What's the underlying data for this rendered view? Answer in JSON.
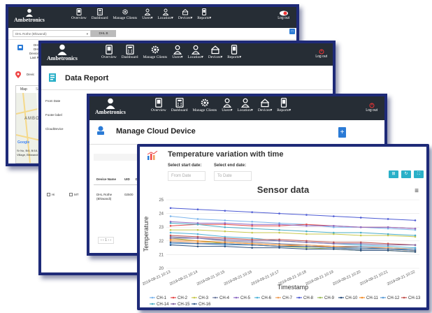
{
  "nav": {
    "brand": "Ambetronics",
    "items": [
      {
        "label": "Overview",
        "icon": "tablet-icon"
      },
      {
        "label": "Dashboard",
        "icon": "calculator-icon"
      },
      {
        "label": "Manage Clients",
        "icon": "gear-icon"
      },
      {
        "label": "Users▾",
        "icon": "user-icon"
      },
      {
        "label": "Location▾",
        "icon": "user-icon"
      },
      {
        "label": "Devices▾",
        "icon": "router-icon"
      },
      {
        "label": "Reports▾",
        "icon": "phone-icon"
      }
    ],
    "logout": "Log out"
  },
  "win1": {
    "device_select": "DHL Rothe (Bhiwandi)",
    "select_button": "DHL B",
    "info_a": "DHL",
    "info_b": "DHL",
    "info_c": "Device",
    "info_d": "Last Re",
    "info_e": "Devic",
    "map_tab": "Map",
    "sat_tab": "Sate",
    "map_place": "AMBO",
    "map_place2": "Village, Bhiwandi",
    "map_addr": "Sr No, B/4, B/18,",
    "map_brand": "Google"
  },
  "win2": {
    "title": "Data Report",
    "fields": [
      "From Date",
      "Footer label",
      "CloudDevice"
    ],
    "checkbox_a": "Hi",
    "checkbox_b": "MT"
  },
  "win3": {
    "title": "Manage Cloud Device",
    "table_headers": [
      "Device Name",
      "UID",
      "Di"
    ],
    "row_name": "DHL Rothe (Bhiwandi)",
    "row_uid": "02500",
    "pager": "‹ ‹ 1 › ›"
  },
  "win4": {
    "title": "Temperature variation with time",
    "start_label": "Select start date:",
    "start_placeholder": "From Date",
    "end_label": "Select end date:",
    "end_placeholder": "To Date",
    "btn_icons": [
      "grid-icon",
      "refresh-icon",
      "expand-icon"
    ],
    "btn_glyphs": [
      "⊞",
      "↻",
      "⛶"
    ],
    "menu_glyph": "≡"
  },
  "colors": {
    "nav_bg": "#262d35",
    "frame": "#1e2a78",
    "accent": "#2b7bd6",
    "teal": "#2ab0c8"
  },
  "chart_data": {
    "type": "line",
    "title": "Sensor data",
    "xlabel": "Timestamp",
    "ylabel": "Temperature",
    "ylim": [
      20,
      25
    ],
    "yticks": [
      20,
      21,
      22,
      23,
      24,
      25
    ],
    "x": [
      "2019-09-21 10:13",
      "2019-09-21 10:14",
      "2019-09-21 10:15",
      "2019-09-21 10:16",
      "2019-09-21 10:17",
      "2019-09-21 10:18",
      "2019-09-21 10:19",
      "2019-09-21 10:20",
      "2019-09-21 10:21",
      "2019-09-21 10:22"
    ],
    "legend": "bottom",
    "series": [
      {
        "name": "CH-1",
        "color": "#7cb5ec",
        "values": [
          23.8,
          23.6,
          23.5,
          23.4,
          23.3,
          23.2,
          23.0,
          23.0,
          22.9,
          22.8
        ]
      },
      {
        "name": "CH-2",
        "color": "#e44a4a",
        "values": [
          23.1,
          23.2,
          23.2,
          23.1,
          23.1,
          23.2,
          23.1,
          23.0,
          23.0,
          22.9
        ]
      },
      {
        "name": "CH-3",
        "color": "#c8c84e",
        "values": [
          22.8,
          22.8,
          22.7,
          22.6,
          22.6,
          22.5,
          22.5,
          22.4,
          22.4,
          22.3
        ]
      },
      {
        "name": "CH-4",
        "color": "#6d7a9e",
        "values": [
          22.3,
          22.2,
          22.0,
          21.9,
          21.8,
          21.7,
          21.6,
          21.6,
          21.5,
          21.4
        ]
      },
      {
        "name": "CH-5",
        "color": "#8e6cc4",
        "values": [
          23.4,
          23.3,
          23.3,
          23.2,
          23.2,
          23.1,
          23.1,
          23.0,
          23.0,
          22.9
        ]
      },
      {
        "name": "CH-6",
        "color": "#4fb3d9",
        "values": [
          22.6,
          22.5,
          22.3,
          22.2,
          22.0,
          21.9,
          21.8,
          21.7,
          21.6,
          21.5
        ]
      },
      {
        "name": "CH-7",
        "color": "#f0a05a",
        "values": [
          22.0,
          21.9,
          21.9,
          21.8,
          21.7,
          21.7,
          21.6,
          21.5,
          21.5,
          21.4
        ]
      },
      {
        "name": "CH-8",
        "color": "#4d5bd4",
        "values": [
          24.4,
          24.3,
          24.2,
          24.1,
          24.0,
          23.9,
          23.8,
          23.7,
          23.6,
          23.5
        ]
      },
      {
        "name": "CH-9",
        "color": "#9bbb59",
        "values": [
          22.2,
          22.0,
          21.8,
          21.7,
          21.6,
          21.5,
          21.4,
          21.3,
          21.3,
          21.2
        ]
      },
      {
        "name": "CH-10",
        "color": "#2c4f7c",
        "values": [
          21.7,
          21.6,
          21.6,
          21.5,
          21.5,
          21.4,
          21.4,
          21.3,
          21.3,
          21.2
        ]
      },
      {
        "name": "CH-11",
        "color": "#f28e2b",
        "values": [
          22.1,
          22.0,
          21.9,
          21.8,
          21.7,
          21.6,
          21.6,
          21.5,
          21.4,
          21.3
        ]
      },
      {
        "name": "CH-12",
        "color": "#5a9bd5",
        "values": [
          21.8,
          21.8,
          21.7,
          21.7,
          21.6,
          21.6,
          21.5,
          21.5,
          21.4,
          21.4
        ]
      },
      {
        "name": "CH-13",
        "color": "#c0504d",
        "values": [
          22.4,
          22.3,
          22.2,
          22.1,
          22.1,
          22.0,
          21.9,
          21.9,
          21.8,
          21.7
        ]
      },
      {
        "name": "CH-14",
        "color": "#4bacc6",
        "values": [
          23.3,
          23.2,
          23.0,
          22.9,
          22.8,
          22.7,
          22.6,
          22.6,
          22.5,
          22.4
        ]
      },
      {
        "name": "CH-15",
        "color": "#8064a2",
        "values": [
          22.2,
          22.2,
          22.1,
          22.0,
          22.0,
          21.9,
          21.8,
          21.8,
          21.7,
          21.7
        ]
      },
      {
        "name": "CH-16",
        "color": "#3a5f8f",
        "values": [
          21.9,
          21.8,
          21.8,
          21.7,
          21.6,
          21.6,
          21.5,
          21.4,
          21.4,
          21.3
        ]
      }
    ]
  }
}
